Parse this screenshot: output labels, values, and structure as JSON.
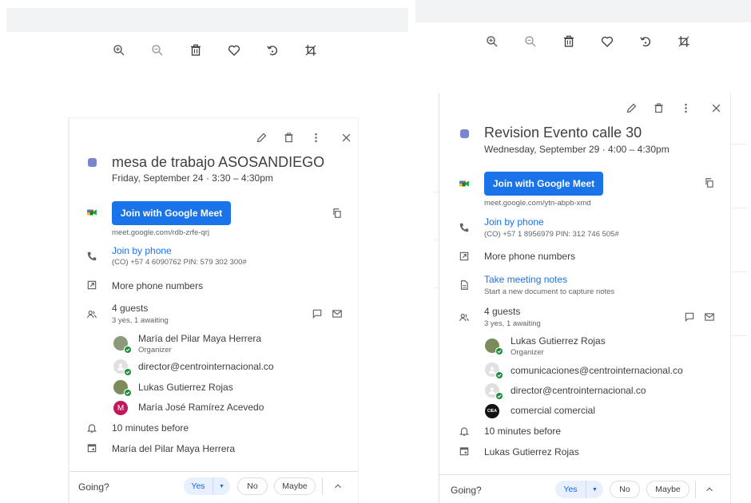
{
  "toolbar": {
    "icons": [
      "zoom-in-icon",
      "zoom-out-icon",
      "trash-icon",
      "heart-icon",
      "rotate-icon",
      "crop-icon"
    ]
  },
  "left_event": {
    "title": "mesa de trabajo ASOSANDIEGO",
    "datetime": "Friday, September 24  ·  3:30 – 4:30pm",
    "meet_button": "Join with Google Meet",
    "meet_link": "meet.google.com/rdb-zrfe-qrj",
    "phone_label": "Join by phone",
    "phone_detail": "(CO) +57 4 6090762 PIN: 579 302 300#",
    "more_phones": "More phone numbers",
    "guests_count": "4 guests",
    "guests_status": "3 yes, 1 awaiting",
    "guests": [
      {
        "name": "María del Pilar Maya Herrera",
        "role": "Organizer"
      },
      {
        "name": "director@centrointernacional.co",
        "role": ""
      },
      {
        "name": "Lukas Gutierrez Rojas",
        "role": ""
      },
      {
        "name": "María José Ramírez Acevedo",
        "role": "",
        "initial": "M"
      }
    ],
    "reminder": "10 minutes before",
    "calendar_owner": "María del Pilar Maya Herrera",
    "footer": {
      "going": "Going?",
      "yes": "Yes",
      "no": "No",
      "maybe": "Maybe"
    }
  },
  "right_event": {
    "title": "Revision Evento calle 30",
    "datetime": "Wednesday, September 29  ·  4:00 – 4:30pm",
    "meet_button": "Join with Google Meet",
    "meet_link": "meet.google.com/ytn-abpb-xmd",
    "phone_label": "Join by phone",
    "phone_detail": "(CO) +57 1 8956979 PIN: 312 746 505#",
    "more_phones": "More phone numbers",
    "notes_label": "Take meeting notes",
    "notes_detail": "Start a new document to capture notes",
    "guests_count": "4 guests",
    "guests_status": "3 yes, 1 awaiting",
    "guests": [
      {
        "name": "Lukas Gutierrez Rojas",
        "role": "Organizer"
      },
      {
        "name": "comunicaciones@centrointernacional.co",
        "role": ""
      },
      {
        "name": "director@centrointernacional.co",
        "role": ""
      },
      {
        "name": "comercial comercial",
        "role": "",
        "initial": "CIEA"
      }
    ],
    "reminder": "10 minutes before",
    "calendar_owner": "Lukas Gutierrez Rojas",
    "footer": {
      "going": "Going?",
      "yes": "Yes",
      "no": "No",
      "maybe": "Maybe"
    }
  },
  "colors": {
    "accent": "#1a73e8",
    "event_square": "#7986cb",
    "yes_bg": "#e8f0fe"
  }
}
